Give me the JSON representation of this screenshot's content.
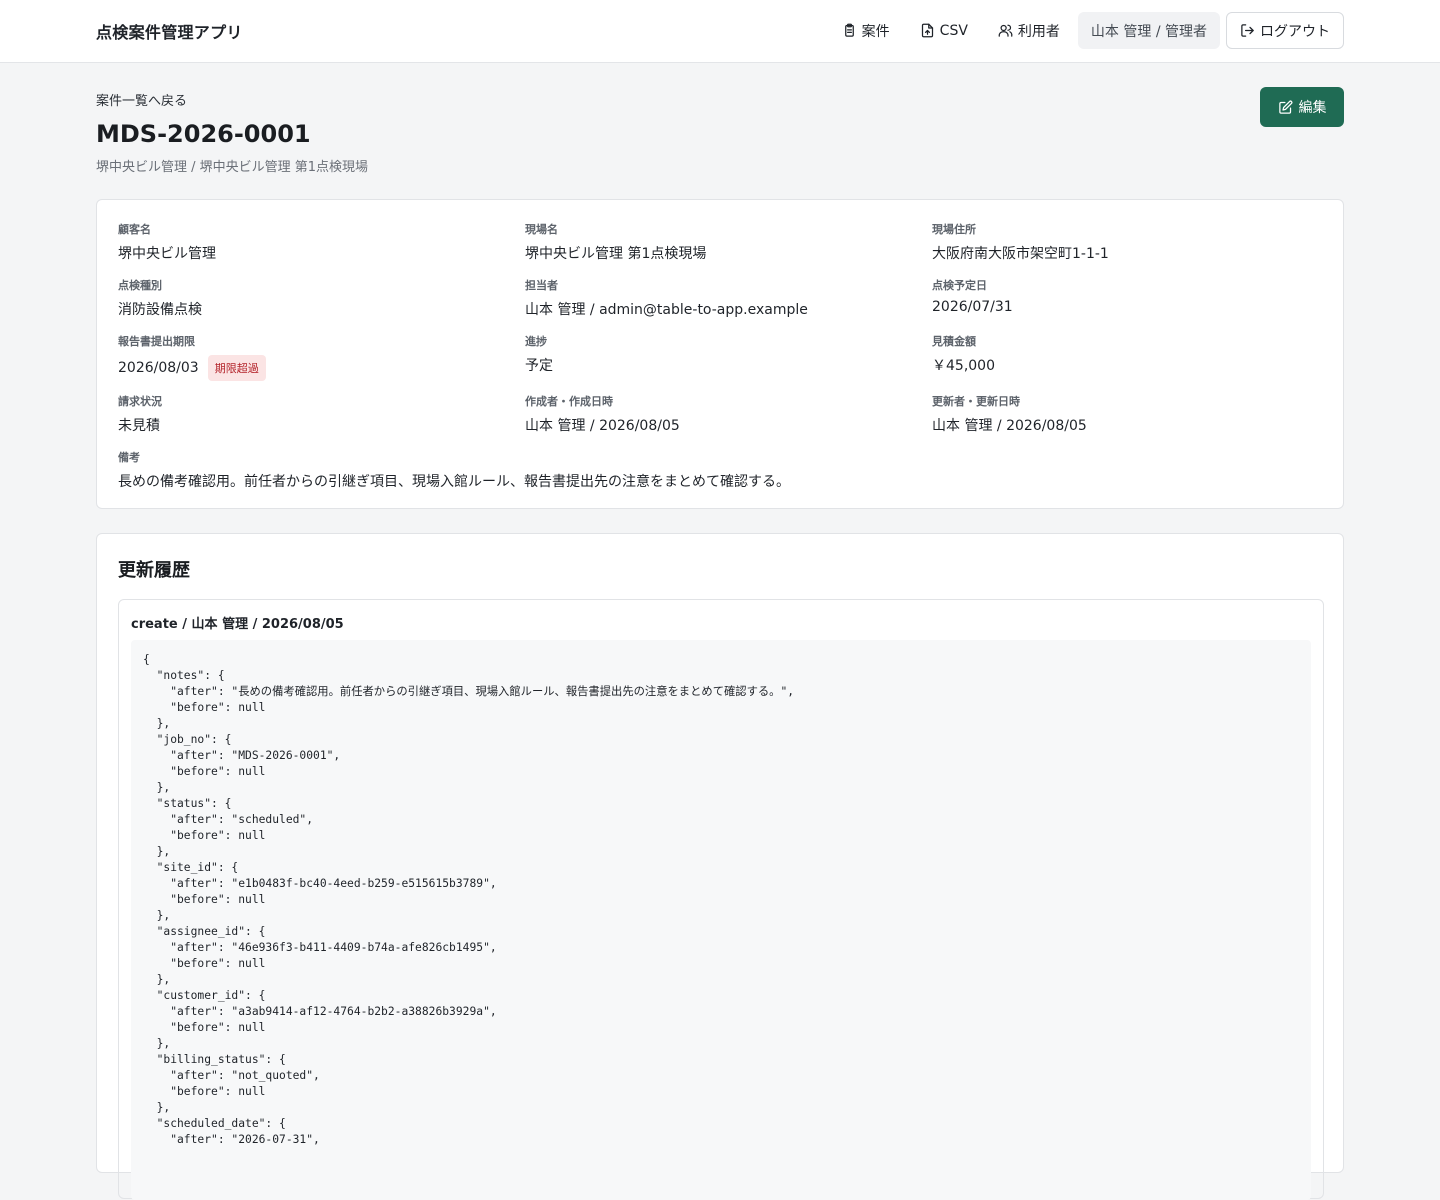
{
  "app": {
    "title": "点検案件管理アプリ"
  },
  "nav": {
    "jobs_label": "案件",
    "csv_label": "CSV",
    "users_label": "利用者",
    "user_chip": "山本 管理 / 管理者",
    "logout_label": "ログアウト"
  },
  "header": {
    "back_label": "案件一覧へ戻る",
    "job_no": "MDS-2026-0001",
    "subtitle": "堺中央ビル管理 / 堺中央ビル管理 第1点検現場",
    "edit_label": "編集"
  },
  "details": {
    "customer": {
      "label": "顧客名",
      "value": "堺中央ビル管理"
    },
    "site": {
      "label": "現場名",
      "value": "堺中央ビル管理 第1点検現場"
    },
    "address": {
      "label": "現場住所",
      "value": "大阪府南大阪市架空町1-1-1"
    },
    "inspection_type": {
      "label": "点検種別",
      "value": "消防設備点検"
    },
    "assignee": {
      "label": "担当者",
      "value": "山本 管理 / admin@table-to-app.example"
    },
    "scheduled_date": {
      "label": "点検予定日",
      "value": "2026/07/31"
    },
    "report_due": {
      "label": "報告書提出期限",
      "value": "2026/08/03",
      "badge": "期限超過"
    },
    "status": {
      "label": "進捗",
      "value": "予定"
    },
    "estimate": {
      "label": "見積金額",
      "value": "￥45,000"
    },
    "billing": {
      "label": "請求状況",
      "value": "未見積"
    },
    "created": {
      "label": "作成者・作成日時",
      "value": "山本 管理 / 2026/08/05"
    },
    "updated": {
      "label": "更新者・更新日時",
      "value": "山本 管理 / 2026/08/05"
    },
    "notes": {
      "label": "備考",
      "value": "長めの備考確認用。前任者からの引継ぎ項目、現場入館ルール、報告書提出先の注意をまとめて確認する。"
    }
  },
  "history": {
    "title": "更新履歴",
    "entry_header": "create / 山本 管理 / 2026/08/05",
    "code": "{\n  \"notes\": {\n    \"after\": \"長めの備考確認用。前任者からの引継ぎ項目、現場入館ルール、報告書提出先の注意をまとめて確認する。\",\n    \"before\": null\n  },\n  \"job_no\": {\n    \"after\": \"MDS-2026-0001\",\n    \"before\": null\n  },\n  \"status\": {\n    \"after\": \"scheduled\",\n    \"before\": null\n  },\n  \"site_id\": {\n    \"after\": \"e1b0483f-bc40-4eed-b259-e515615b3789\",\n    \"before\": null\n  },\n  \"assignee_id\": {\n    \"after\": \"46e936f3-b411-4409-b74a-afe826cb1495\",\n    \"before\": null\n  },\n  \"customer_id\": {\n    \"after\": \"a3ab9414-af12-4764-b2b2-a38826b3929a\",\n    \"before\": null\n  },\n  \"billing_status\": {\n    \"after\": \"not_quoted\",\n    \"before\": null\n  },\n  \"scheduled_date\": {\n    \"after\": \"2026-07-31\","
  },
  "colors": {
    "accent": "#1f6b54",
    "badge_bg": "#fbe4e4",
    "badge_text": "#b4232a"
  }
}
